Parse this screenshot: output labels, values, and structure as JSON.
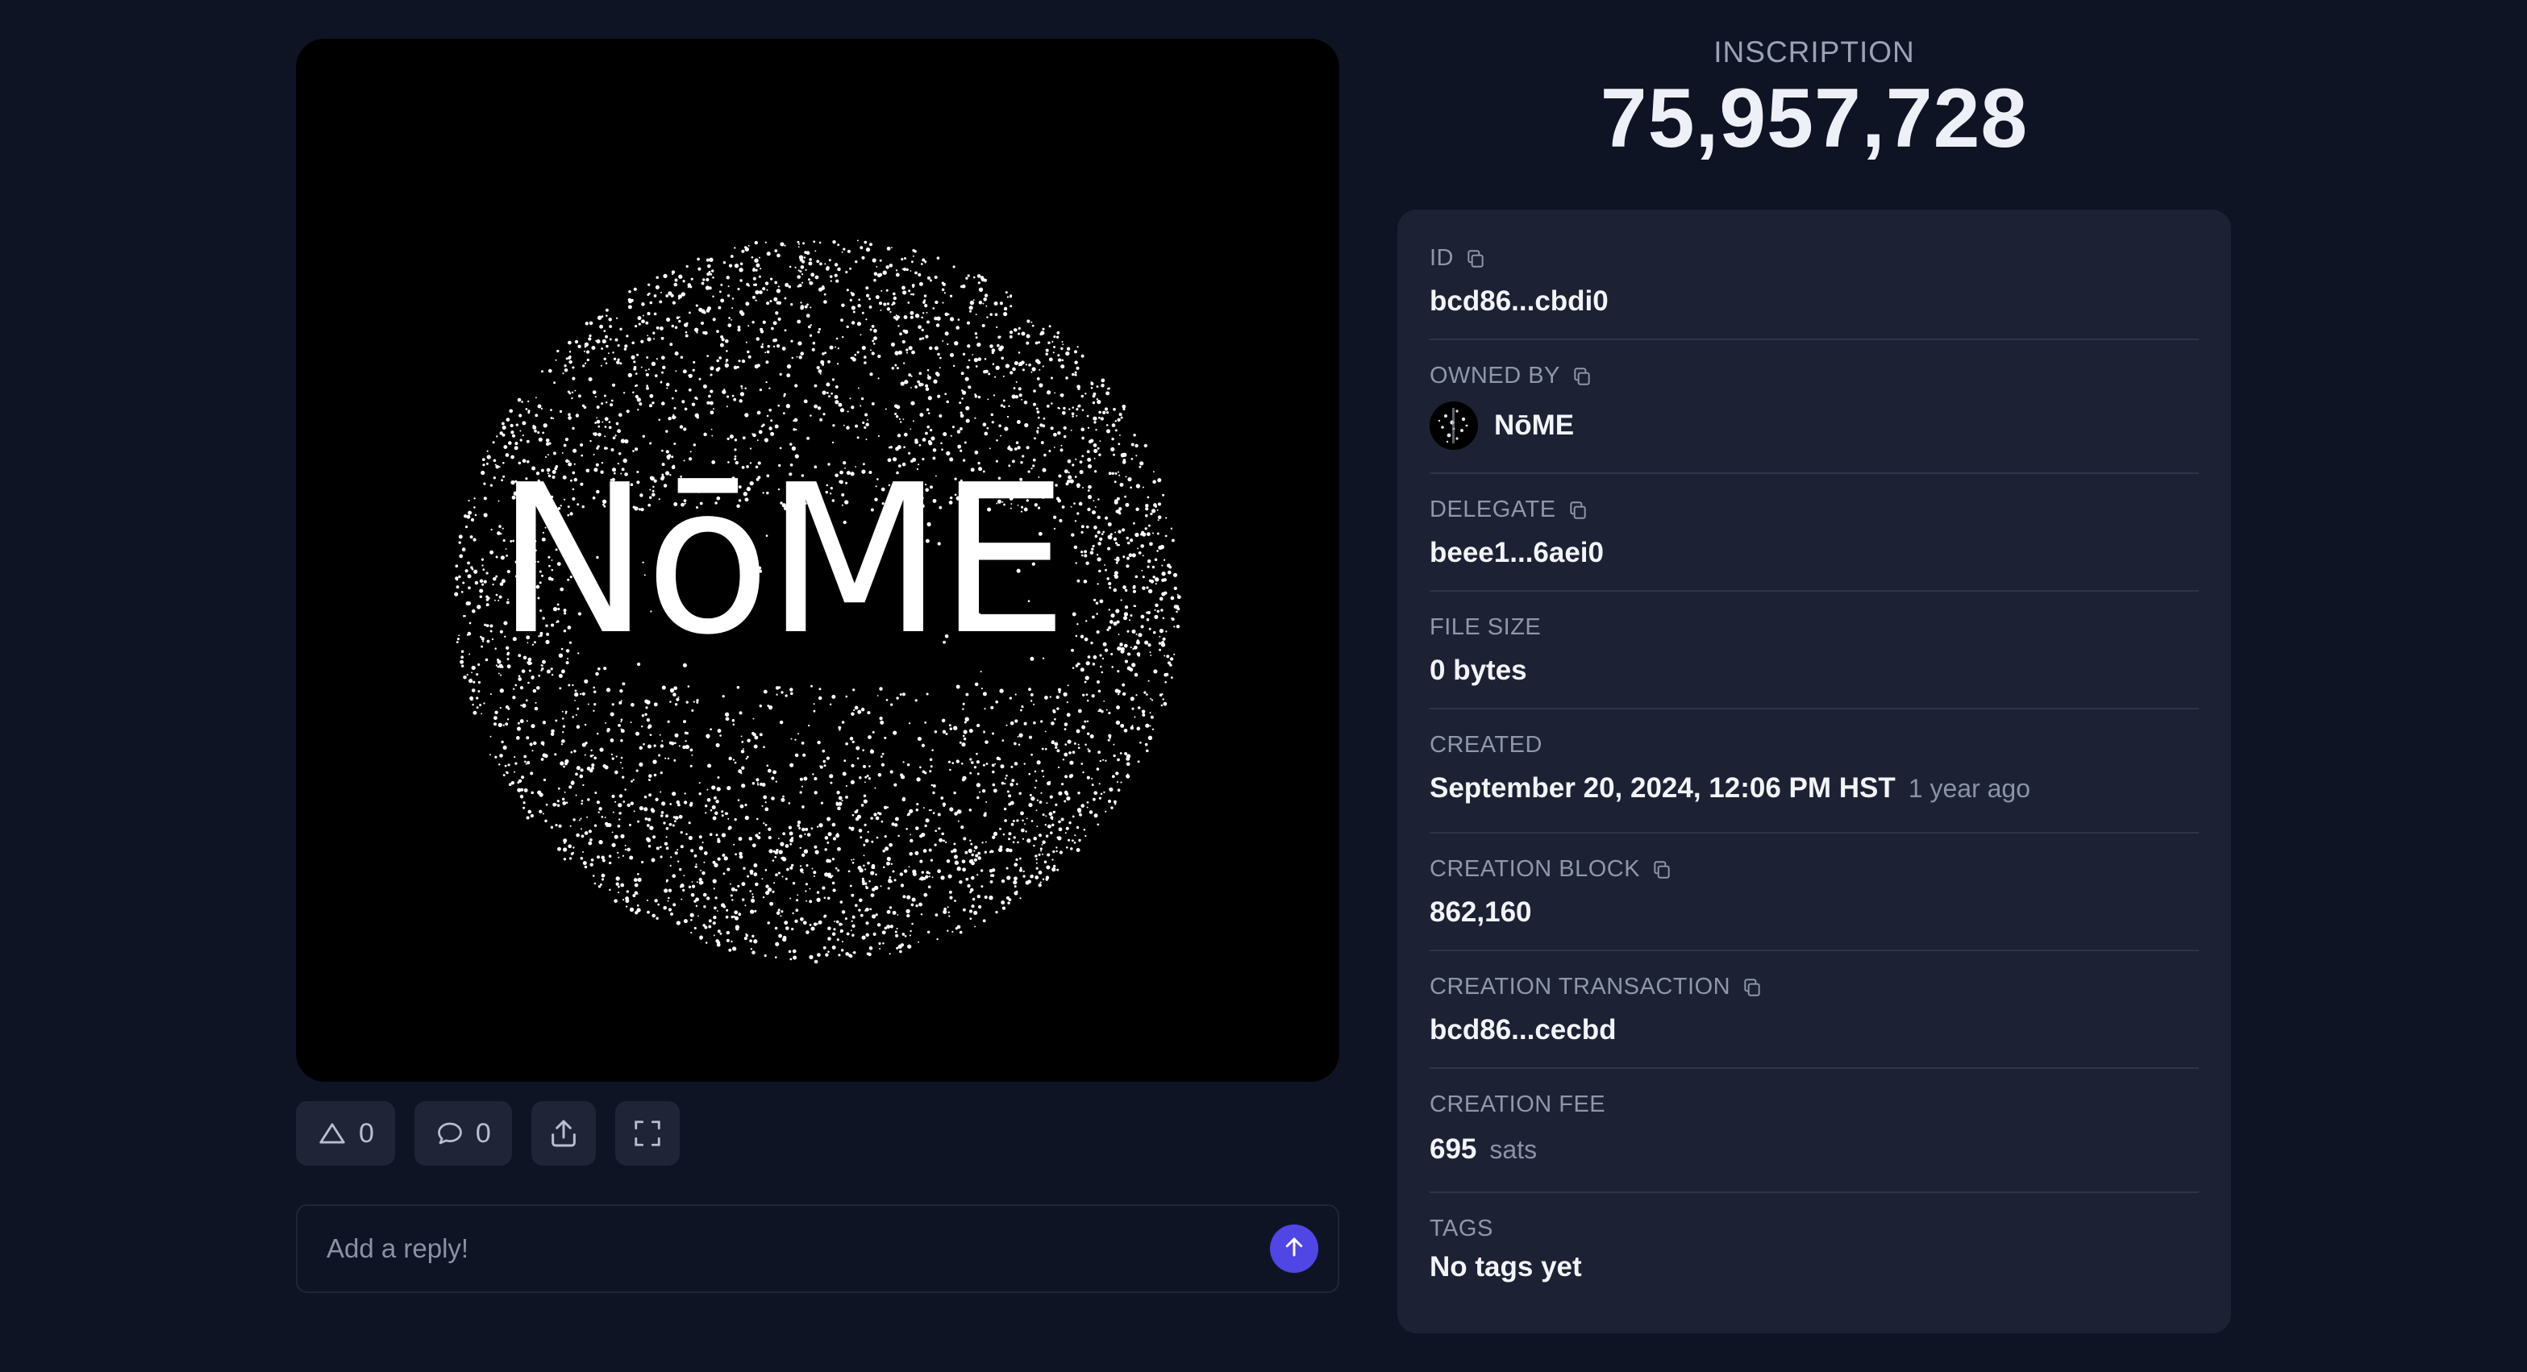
{
  "inscription": {
    "label": "INSCRIPTION",
    "number": "75,957,728"
  },
  "artwork": {
    "wordmark": "NōME",
    "background": "#000000",
    "foreground": "#ffffff"
  },
  "actions": {
    "upvote_icon": "triangle-up-icon",
    "upvote_count": "0",
    "comment_icon": "comment-bubble-icon",
    "comment_count": "0",
    "share_icon": "share-upload-icon",
    "fullscreen_icon": "fullscreen-icon"
  },
  "reply": {
    "placeholder": "Add a reply!",
    "send_icon": "arrow-up-icon",
    "send_color": "#4f46e5"
  },
  "details": {
    "id": {
      "label": "ID",
      "value": "bcd86...cbdi0"
    },
    "owned_by": {
      "label": "OWNED BY",
      "value": "NōME"
    },
    "delegate": {
      "label": "DELEGATE",
      "value": "beee1...6aei0"
    },
    "file_size": {
      "label": "FILE SIZE",
      "value": "0 bytes"
    },
    "created": {
      "label": "CREATED",
      "value": "September 20, 2024, 12:06 PM HST",
      "relative": "1 year ago"
    },
    "creation_block": {
      "label": "CREATION BLOCK",
      "value": "862,160"
    },
    "creation_transaction": {
      "label": "CREATION TRANSACTION",
      "value": "bcd86...cecbd"
    },
    "creation_fee": {
      "label": "CREATION FEE",
      "value": "695",
      "unit": "sats"
    },
    "tags": {
      "label": "TAGS",
      "value": "No tags yet"
    }
  }
}
